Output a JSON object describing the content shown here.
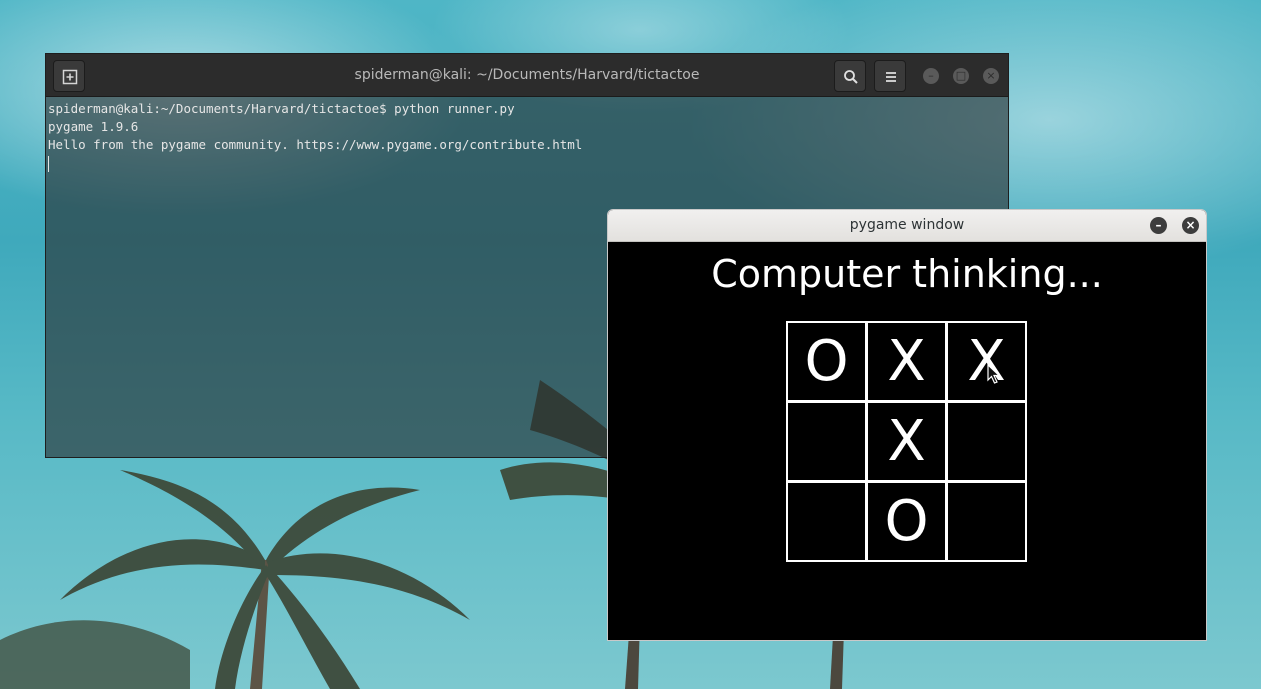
{
  "terminal": {
    "title": "spiderman@kali: ~/Documents/Harvard/tictactoe",
    "new_tab_icon": "new-tab-icon",
    "search_icon": "search-icon",
    "menu_icon": "hamburger-menu-icon",
    "lines": [
      "spiderman@kali:~/Documents/Harvard/tictactoe$ python runner.py",
      "pygame 1.9.6",
      "Hello from the pygame community. https://www.pygame.org/contribute.html"
    ]
  },
  "pygame": {
    "title": "pygame window",
    "status": "Computer thinking...",
    "board": [
      [
        "O",
        "X",
        "X"
      ],
      [
        "",
        "X",
        ""
      ],
      [
        "",
        "O",
        ""
      ]
    ]
  }
}
